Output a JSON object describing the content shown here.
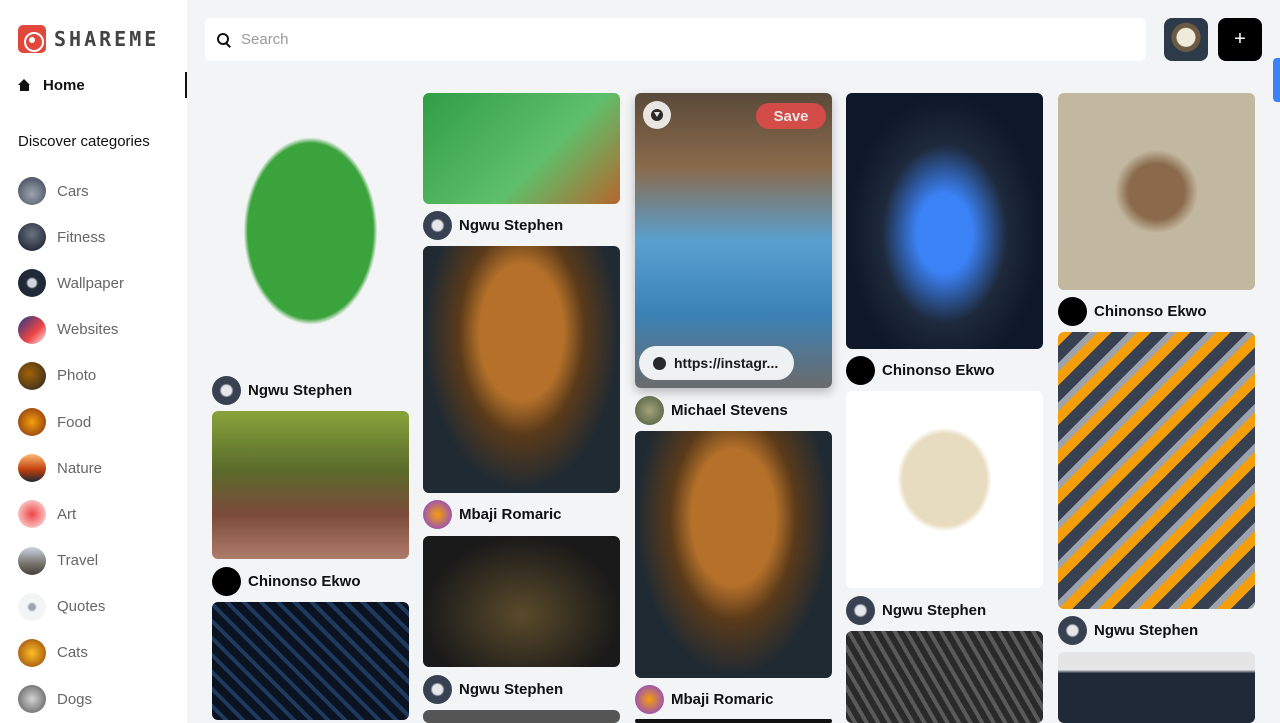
{
  "app": {
    "name": "SHAREME"
  },
  "sidebar": {
    "home_label": "Home",
    "discover_label": "Discover categories",
    "categories": [
      {
        "label": "Cars",
        "color": "#6b7280"
      },
      {
        "label": "Fitness",
        "color": "#374151"
      },
      {
        "label": "Wallpaper",
        "color": "#4b5563"
      },
      {
        "label": "Websites",
        "color": "#1e3a8a"
      },
      {
        "label": "Photo",
        "color": "#5b3a2a"
      },
      {
        "label": "Food",
        "color": "#a16207"
      },
      {
        "label": "Nature",
        "color": "#c2410c"
      },
      {
        "label": "Art",
        "color": "#dc2626"
      },
      {
        "label": "Travel",
        "color": "#78716c"
      },
      {
        "label": "Quotes",
        "color": "#e5e7eb"
      },
      {
        "label": "Cats",
        "color": "#b45309"
      },
      {
        "label": "Dogs",
        "color": "#6b6b6b"
      }
    ]
  },
  "search": {
    "placeholder": "Search",
    "value": ""
  },
  "header": {
    "add_label": "+"
  },
  "pins": {
    "save_label": "Save",
    "link_label": "https://instagr...",
    "authors": {
      "a1": "Ngwu Stephen",
      "a2": "Chinonso Ekwo",
      "b1": "Ngwu Stephen",
      "b2": "Mbaji Romaric",
      "b3": "Ngwu Stephen",
      "c1": "Michael Stevens",
      "c2": "Mbaji Romaric",
      "d1": "Chinonso Ekwo",
      "d2": "Ngwu Stephen",
      "e1": "Chinonso Ekwo",
      "e2": "Ngwu Stephen"
    }
  }
}
